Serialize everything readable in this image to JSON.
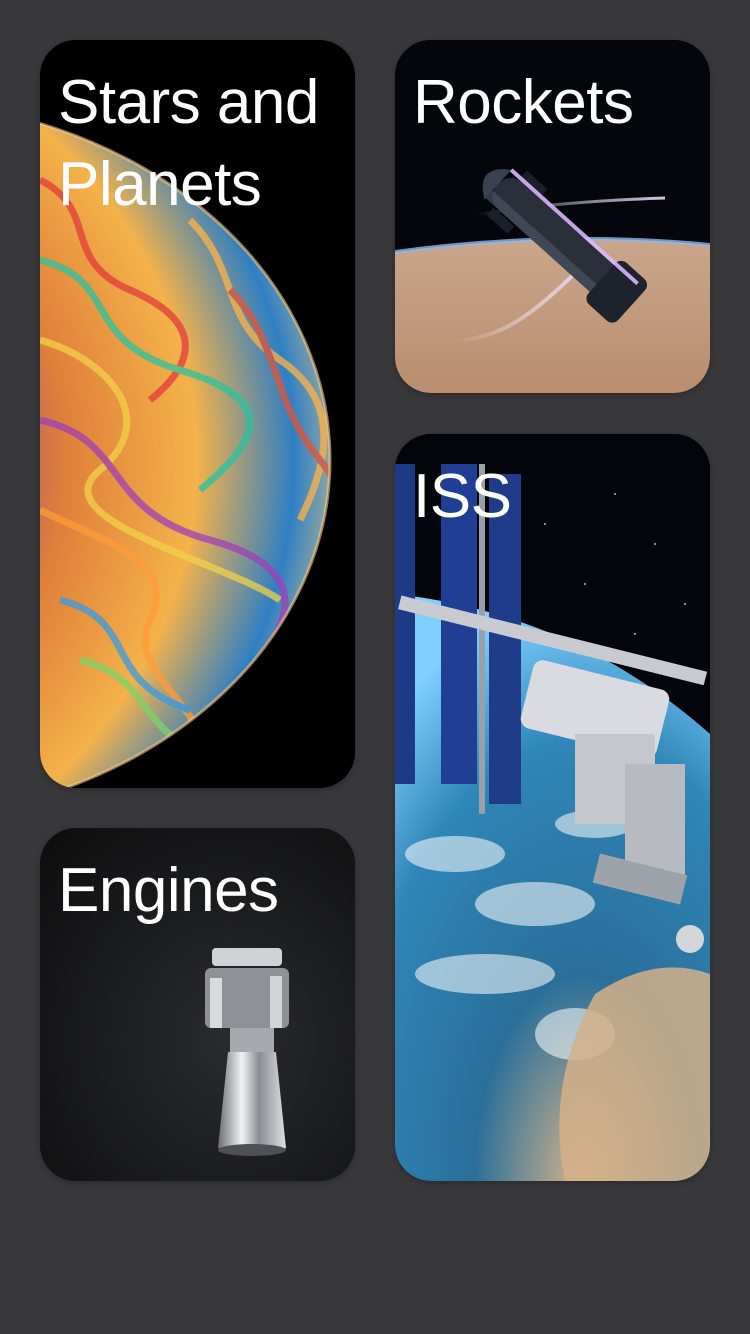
{
  "cards": [
    {
      "id": "stars-and-planets",
      "title": "Stars and Planets",
      "image": "planet-bubble-image"
    },
    {
      "id": "rockets",
      "title": "Rockets",
      "image": "starship-rocket-image"
    },
    {
      "id": "iss",
      "title": "ISS",
      "image": "space-station-image"
    },
    {
      "id": "engines",
      "title": "Engines",
      "image": "rocket-engine-image"
    }
  ],
  "colors": {
    "background": "#38383a",
    "title_text": "#ffffff"
  }
}
